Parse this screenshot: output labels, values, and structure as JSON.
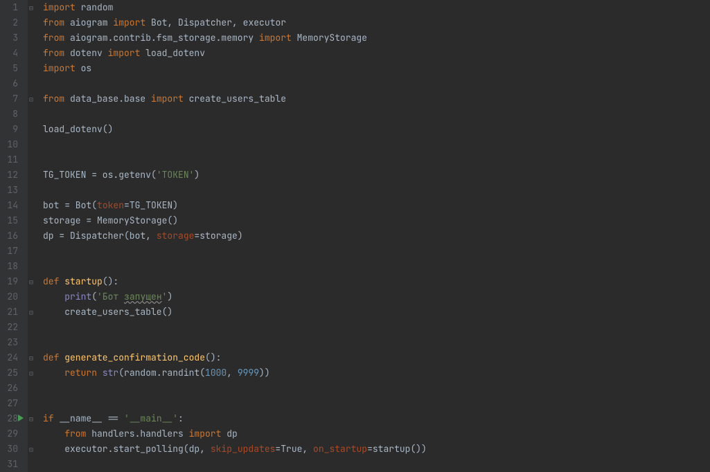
{
  "lines": [
    {
      "n": 1,
      "fold": "⊟",
      "tokens": [
        [
          "kw",
          "import"
        ],
        [
          "id",
          " random"
        ]
      ]
    },
    {
      "n": 2,
      "fold": "",
      "tokens": [
        [
          "kw",
          "from"
        ],
        [
          "id",
          " aiogram "
        ],
        [
          "kw",
          "import"
        ],
        [
          "id",
          " Bot"
        ],
        [
          "punct",
          ", "
        ],
        [
          "id",
          "Dispatcher"
        ],
        [
          "punct",
          ", "
        ],
        [
          "id",
          "executor"
        ]
      ]
    },
    {
      "n": 3,
      "fold": "",
      "tokens": [
        [
          "kw",
          "from"
        ],
        [
          "id",
          " aiogram.contrib.fsm_storage.memory "
        ],
        [
          "kw",
          "import"
        ],
        [
          "id",
          " MemoryStorage"
        ]
      ]
    },
    {
      "n": 4,
      "fold": "",
      "tokens": [
        [
          "kw",
          "from"
        ],
        [
          "id",
          " dotenv "
        ],
        [
          "kw",
          "import"
        ],
        [
          "id",
          " load_dotenv"
        ]
      ]
    },
    {
      "n": 5,
      "fold": "",
      "tokens": [
        [
          "kw",
          "import"
        ],
        [
          "id",
          " os"
        ]
      ]
    },
    {
      "n": 6,
      "fold": "",
      "tokens": []
    },
    {
      "n": 7,
      "fold": "⊡",
      "tokens": [
        [
          "kw",
          "from"
        ],
        [
          "id",
          " data_base.base "
        ],
        [
          "kw",
          "import"
        ],
        [
          "id",
          " create_users_table"
        ]
      ]
    },
    {
      "n": 8,
      "fold": "",
      "tokens": []
    },
    {
      "n": 9,
      "fold": "",
      "tokens": [
        [
          "id",
          "load_dotenv()"
        ]
      ]
    },
    {
      "n": 10,
      "fold": "",
      "tokens": []
    },
    {
      "n": 11,
      "fold": "",
      "tokens": []
    },
    {
      "n": 12,
      "fold": "",
      "tokens": [
        [
          "id",
          "TG_TOKEN = os.getenv("
        ],
        [
          "str",
          "'TOKEN'"
        ],
        [
          "id",
          ")"
        ]
      ]
    },
    {
      "n": 13,
      "fold": "",
      "tokens": []
    },
    {
      "n": 14,
      "fold": "",
      "tokens": [
        [
          "id",
          "bot = Bot("
        ],
        [
          "param",
          "token"
        ],
        [
          "id",
          "=TG_TOKEN)"
        ]
      ]
    },
    {
      "n": 15,
      "fold": "",
      "tokens": [
        [
          "id",
          "storage = MemoryStorage()"
        ]
      ]
    },
    {
      "n": 16,
      "fold": "",
      "tokens": [
        [
          "id",
          "dp = Dispatcher(bot"
        ],
        [
          "punct",
          ", "
        ],
        [
          "param",
          "storage"
        ],
        [
          "id",
          "=storage)"
        ]
      ]
    },
    {
      "n": 17,
      "fold": "",
      "tokens": []
    },
    {
      "n": 18,
      "fold": "",
      "tokens": []
    },
    {
      "n": 19,
      "fold": "⊟",
      "tokens": [
        [
          "kw",
          "def "
        ],
        [
          "fn",
          "startup"
        ],
        [
          "id",
          "():"
        ]
      ]
    },
    {
      "n": 20,
      "fold": "",
      "tokens": [
        [
          "id",
          "    "
        ],
        [
          "builtin",
          "print"
        ],
        [
          "id",
          "("
        ],
        [
          "str",
          "'Бот "
        ],
        [
          "warn",
          "запущен"
        ],
        [
          "str",
          "'"
        ],
        [
          "id",
          ")"
        ]
      ]
    },
    {
      "n": 21,
      "fold": "⊡",
      "tokens": [
        [
          "id",
          "    create_users_table()"
        ]
      ]
    },
    {
      "n": 22,
      "fold": "",
      "tokens": []
    },
    {
      "n": 23,
      "fold": "",
      "tokens": []
    },
    {
      "n": 24,
      "fold": "⊟",
      "tokens": [
        [
          "kw",
          "def "
        ],
        [
          "fn",
          "generate_confirmation_code"
        ],
        [
          "id",
          "():"
        ]
      ]
    },
    {
      "n": 25,
      "fold": "⊡",
      "tokens": [
        [
          "id",
          "    "
        ],
        [
          "kw",
          "return "
        ],
        [
          "builtin",
          "str"
        ],
        [
          "id",
          "(random.randint("
        ],
        [
          "num",
          "1000"
        ],
        [
          "punct",
          ", "
        ],
        [
          "num",
          "9999"
        ],
        [
          "id",
          "))"
        ]
      ]
    },
    {
      "n": 26,
      "fold": "",
      "tokens": []
    },
    {
      "n": 27,
      "fold": "",
      "tokens": []
    },
    {
      "n": 28,
      "fold": "⊟",
      "play": true,
      "tokens": [
        [
          "kw",
          "if"
        ],
        [
          "id",
          " __name__ == "
        ],
        [
          "str",
          "'__main__'"
        ],
        [
          "id",
          ":"
        ]
      ]
    },
    {
      "n": 29,
      "fold": "",
      "tokens": [
        [
          "id",
          "    "
        ],
        [
          "kw",
          "from"
        ],
        [
          "id",
          " handlers.handlers "
        ],
        [
          "kw",
          "import"
        ],
        [
          "id",
          " dp"
        ]
      ]
    },
    {
      "n": 30,
      "fold": "⊡",
      "tokens": [
        [
          "id",
          "    executor.start_polling(dp"
        ],
        [
          "punct",
          ", "
        ],
        [
          "param",
          "skip_updates"
        ],
        [
          "id",
          "=True"
        ],
        [
          "punct",
          ", "
        ],
        [
          "param",
          "on_startup"
        ],
        [
          "id",
          "=startup())"
        ]
      ]
    },
    {
      "n": 31,
      "fold": "",
      "tokens": []
    }
  ]
}
